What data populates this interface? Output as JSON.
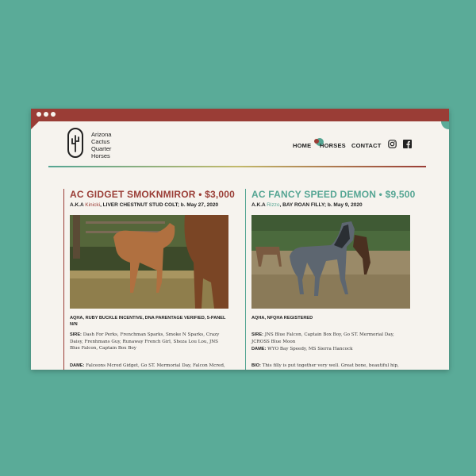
{
  "colors": {
    "background": "#5aab98",
    "window": "#f6f3ee",
    "brand_red": "#9a3d36",
    "brand_teal": "#55a593"
  },
  "brand": {
    "line1": "Arizona",
    "line2": "Cactus",
    "line3": "Quarter",
    "line4": "Horses"
  },
  "nav": {
    "home": "HOME",
    "horses": "HORSES",
    "contact": "CONTACT"
  },
  "icons": {
    "instagram": "instagram-icon",
    "facebook": "facebook-icon",
    "logo": "cactus-icon"
  },
  "left": {
    "title": "AC GIDGET SMOKNMIROR • $3,000",
    "aka_prefix": "A.K.A ",
    "nickname": "Kinicki",
    "aka_suffix": ", LIVER CHESTNUT STUD COLT; b. May 27, 2020",
    "registration": "AQHA, RUBY BUCKLE INCENTIVE, DNA PARENTAGE VERIFIED, 5-PANEL N/N",
    "sire_label": "SIRE:",
    "sire": "Dash For Perks, Frenchman Sparks, Smoke N Sparks, Crazy Daisy, Frenhmans Guy, Runaway French Girl, Sheza Lou Lou, JNS Blue Falcon, Captain Box Boy",
    "dame_label": "DAME:",
    "dame": "Falceons Mcred Gidget, Go ST. Mermorial Day, Falcon Mcred,"
  },
  "right": {
    "title": "AC FANCY SPEED DEMON • $9,500",
    "aka_prefix": "A.K.A ",
    "nickname": "Rizzo",
    "aka_suffix": ", BAY ROAN FILLY; b. May 9, 2020",
    "registration": "AQHA, NFQHA REGISTERED",
    "sire_label": "SIRE:",
    "sire": "JNS Blue Falcon, Captain Box Boy, Go ST. Mermorial Day, JCROSS Blue Moon",
    "dame_label": "DAME:",
    "dame": "WYO Bay Speedy, MS Sierra Hancock",
    "bio_label": "BIO:",
    "bio": "This filly is put together very well. Great bone, beautiful hip,"
  }
}
